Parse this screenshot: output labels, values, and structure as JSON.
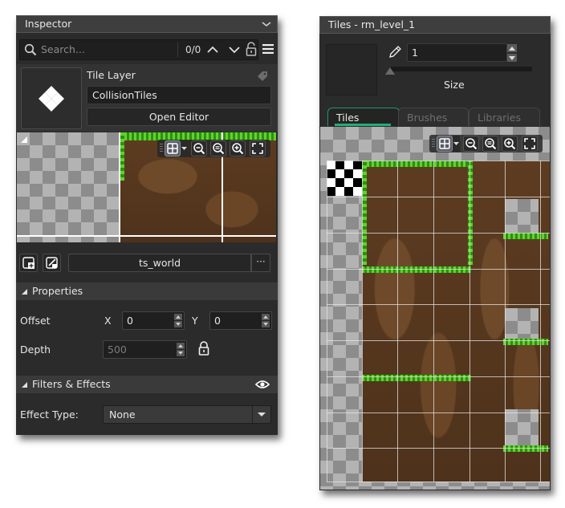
{
  "inspector": {
    "title": "Inspector",
    "search": {
      "placeholder": "Search...",
      "match_count": "0/0"
    },
    "layer": {
      "type_label": "Tile Layer",
      "name_value": "CollisionTiles",
      "open_editor_label": "Open Editor"
    },
    "tileset": {
      "name": "ts_world",
      "more_label": "···"
    },
    "properties": {
      "section_label": "Properties",
      "offset_label": "Offset",
      "x_label": "X",
      "x_value": "0",
      "y_label": "Y",
      "y_value": "0",
      "depth_label": "Depth",
      "depth_value": "500"
    },
    "filters": {
      "section_label": "Filters & Effects",
      "effect_type_label": "Effect Type:",
      "effect_type_value": "None"
    }
  },
  "tiles_panel": {
    "title": "Tiles - rm_level_1",
    "brush_size_value": "1",
    "size_label": "Size",
    "tabs": [
      {
        "label": "Tiles",
        "active": true
      },
      {
        "label": "Brushes",
        "active": false
      },
      {
        "label": "Libraries",
        "active": false
      }
    ]
  },
  "colors": {
    "panel_bg": "#2b2b2b",
    "active_tab_accent": "#1fb07a",
    "grass": "#3fae1a",
    "dirt": "#5a3a20"
  }
}
